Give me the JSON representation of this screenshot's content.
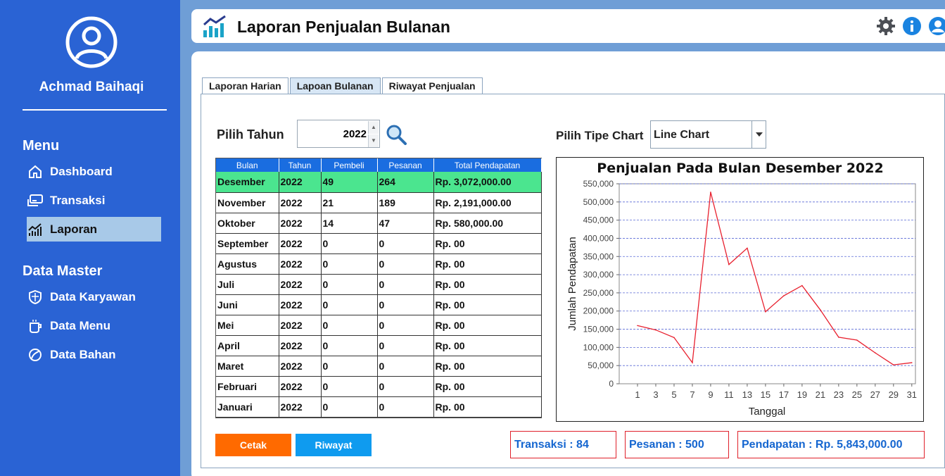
{
  "sidebar": {
    "username": "Achmad Baihaqi",
    "menu_heading": "Menu",
    "menu_items": [
      {
        "label": "Dashboard",
        "icon": "home-icon"
      },
      {
        "label": "Transaksi",
        "icon": "payment-icon"
      },
      {
        "label": "Laporan",
        "icon": "report-chart-icon",
        "active": true
      }
    ],
    "master_heading": "Data Master",
    "master_items": [
      {
        "label": "Data Karyawan",
        "icon": "shield-icon"
      },
      {
        "label": "Data Menu",
        "icon": "cup-icon"
      },
      {
        "label": "Data Bahan",
        "icon": "leaf-icon"
      }
    ]
  },
  "header": {
    "title": "Laporan Penjualan Bulanan",
    "icons": [
      "settings-icon",
      "info-icon",
      "user-icon"
    ]
  },
  "tabs": [
    {
      "label": "Laporan Harian"
    },
    {
      "label": "Lapoan Bulanan",
      "active": true
    },
    {
      "label": "Riwayat Penjualan"
    }
  ],
  "filters": {
    "year_label": "Pilih Tahun",
    "year_value": "2022",
    "chart_type_label": "Pilih Tipe Chart",
    "chart_type_value": "Line Chart"
  },
  "table": {
    "columns": [
      "Bulan",
      "Tahun",
      "Pembeli",
      "Pesanan",
      "Total Pendapatan"
    ],
    "rows": [
      [
        "Desember",
        "2022",
        "49",
        "264",
        "Rp. 3,072,000.00"
      ],
      [
        "November",
        "2022",
        "21",
        "189",
        "Rp. 2,191,000.00"
      ],
      [
        "Oktober",
        "2022",
        "14",
        "47",
        "Rp. 580,000.00"
      ],
      [
        "September",
        "2022",
        "0",
        "0",
        "Rp. 00"
      ],
      [
        "Agustus",
        "2022",
        "0",
        "0",
        "Rp. 00"
      ],
      [
        "Juli",
        "2022",
        "0",
        "0",
        "Rp. 00"
      ],
      [
        "Juni",
        "2022",
        "0",
        "0",
        "Rp. 00"
      ],
      [
        "Mei",
        "2022",
        "0",
        "0",
        "Rp. 00"
      ],
      [
        "April",
        "2022",
        "0",
        "0",
        "Rp. 00"
      ],
      [
        "Maret",
        "2022",
        "0",
        "0",
        "Rp. 00"
      ],
      [
        "Februari",
        "2022",
        "0",
        "0",
        "Rp. 00"
      ],
      [
        "Januari",
        "2022",
        "0",
        "0",
        "Rp. 00"
      ]
    ],
    "selected_row": 0
  },
  "buttons": {
    "print": "Cetak",
    "history": "Riwayat"
  },
  "stats": {
    "transactions": "Transaksi : 84",
    "orders": "Pesanan : 500",
    "revenue": "Pendapatan : Rp. 5,843,000.00"
  },
  "chart_data": {
    "type": "line",
    "title": "Penjualan Pada Bulan Desember 2022",
    "xlabel": "Tanggal",
    "ylabel": "Jumlah Pendapatan",
    "x_ticks": [
      "1",
      "3",
      "5",
      "7",
      "9",
      "11",
      "13",
      "15",
      "17",
      "19",
      "21",
      "23",
      "25",
      "27",
      "29",
      "31"
    ],
    "y_ticks": [
      "0",
      "50,000",
      "100,000",
      "150,000",
      "200,000",
      "250,000",
      "300,000",
      "350,000",
      "400,000",
      "450,000",
      "500,000",
      "550,000"
    ],
    "ylim": [
      0,
      550000
    ],
    "grid": true,
    "color": "#e8202e",
    "x": [
      2,
      4,
      6,
      8,
      10,
      12,
      14,
      16,
      18,
      20,
      22,
      24,
      26,
      28,
      30,
      32
    ],
    "values": [
      160000,
      148000,
      127000,
      58000,
      527000,
      328000,
      373000,
      198000,
      242000,
      270000,
      203000,
      128000,
      120000,
      85000,
      52000,
      58000
    ]
  }
}
